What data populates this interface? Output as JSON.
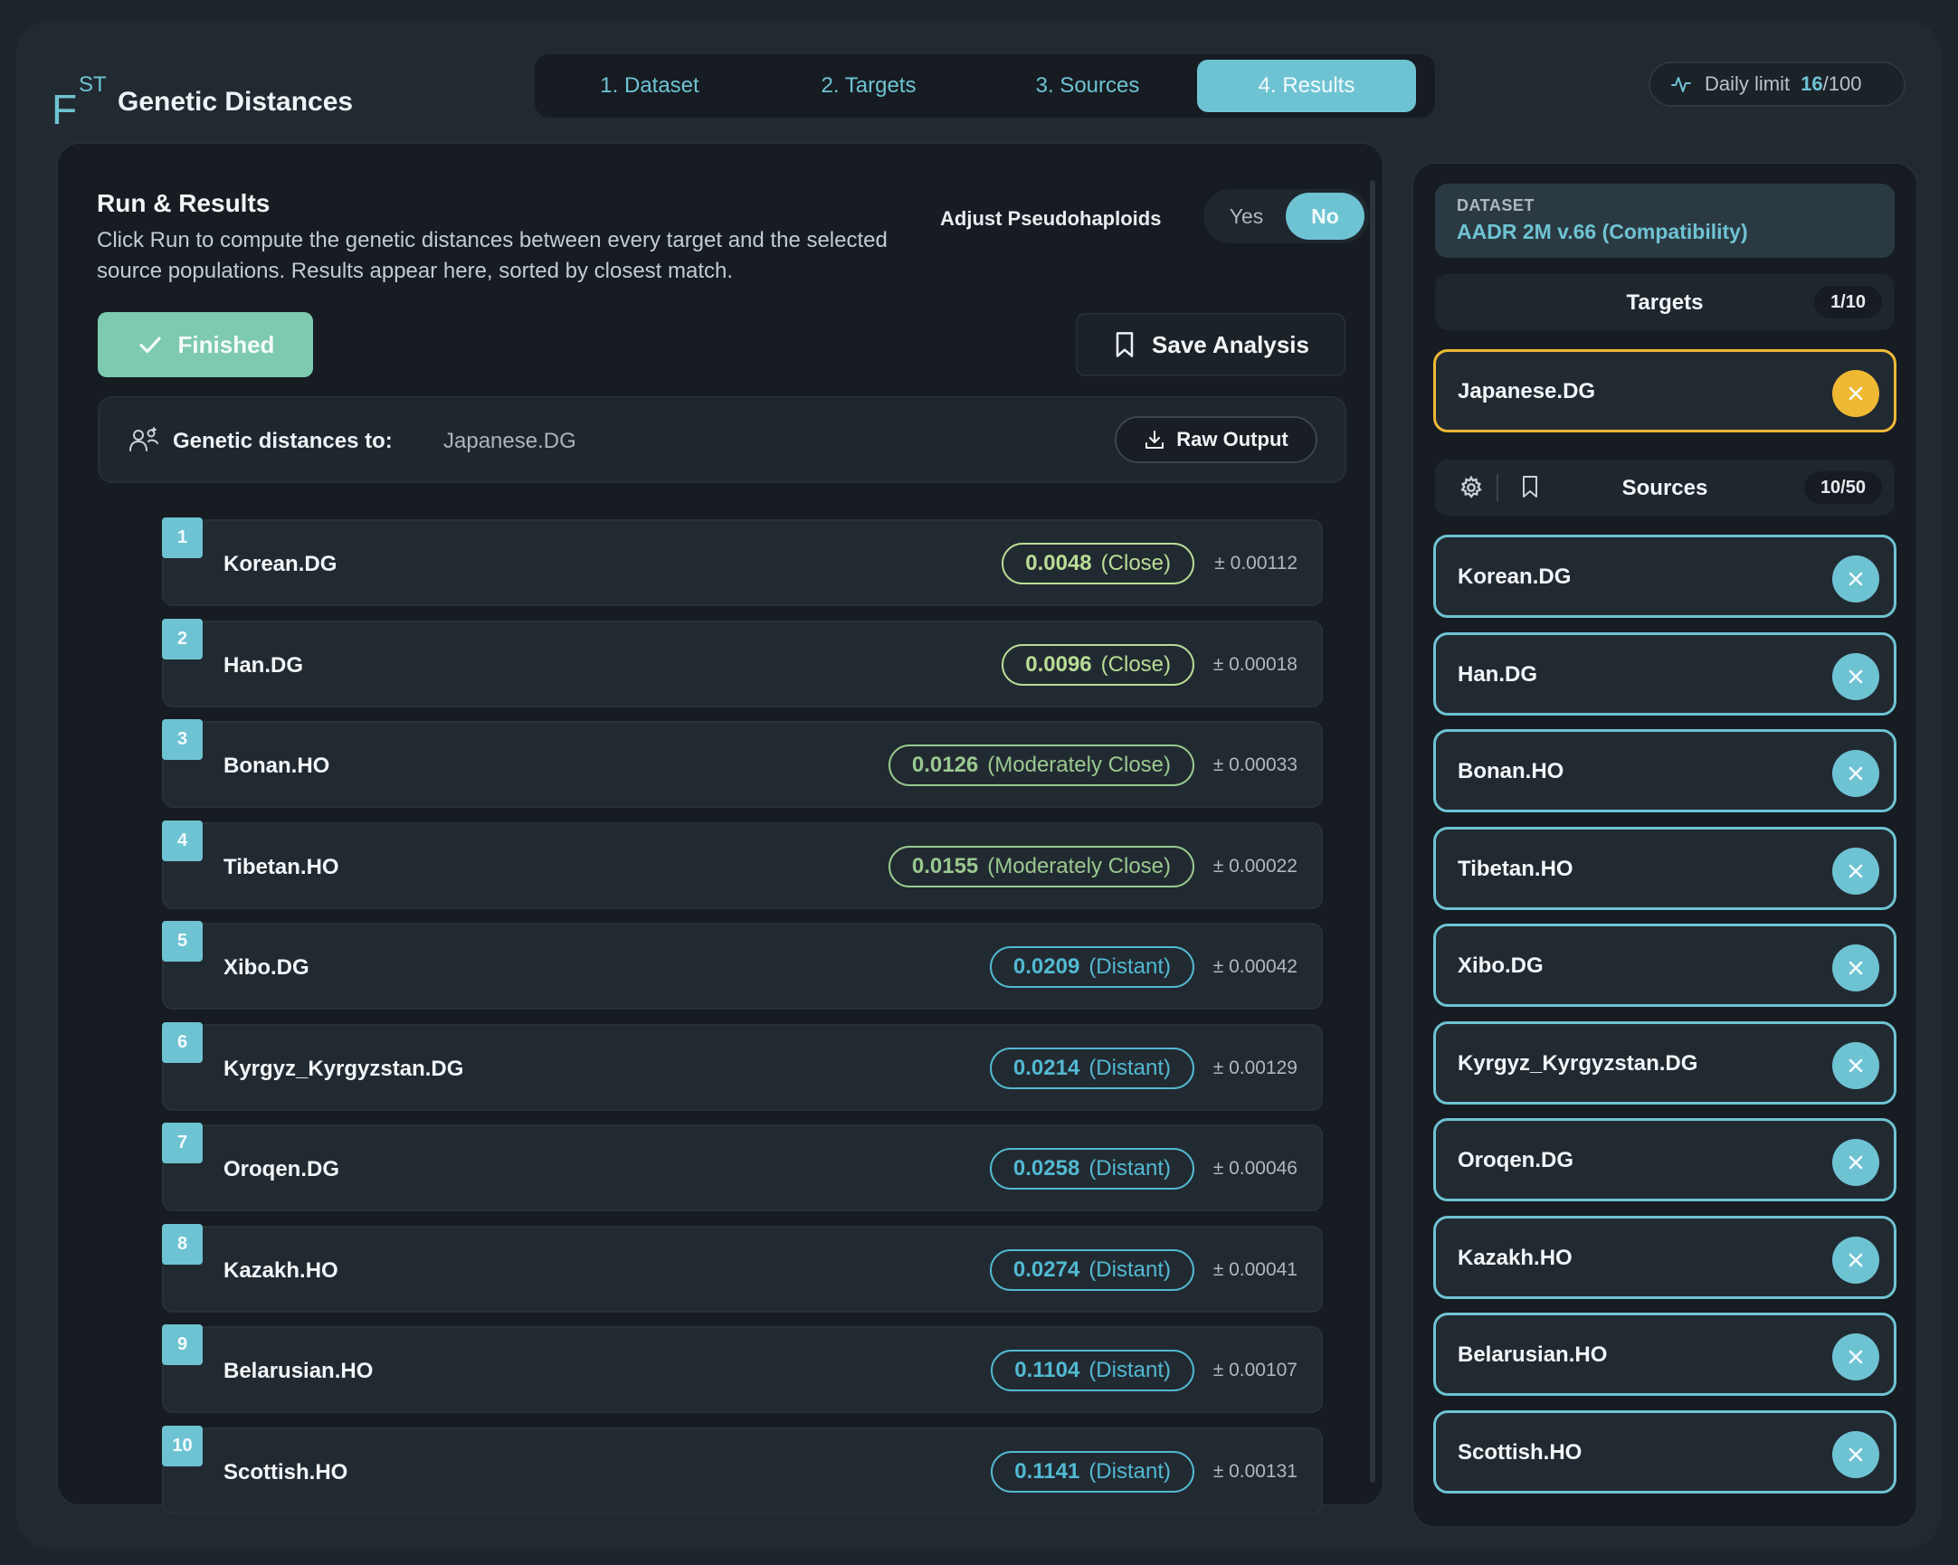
{
  "header": {
    "logo_main": "F",
    "logo_sup": "ST",
    "title": "Genetic Distances",
    "tabs": [
      "1. Dataset",
      "2. Targets",
      "3. Sources",
      "4. Results"
    ],
    "active_tab": 3,
    "limit_label": "Daily limit",
    "limit_used": "16",
    "limit_total": "/100"
  },
  "main": {
    "title": "Run & Results",
    "description": "Click Run to compute the genetic distances between every target and the selected source populations. Results appear here, sorted by closest match.",
    "adjust_label": "Adjust Pseudohaploids",
    "toggle_yes": "Yes",
    "toggle_no": "No",
    "toggle_selected": "No",
    "finished_label": "Finished",
    "save_label": "Save Analysis",
    "distances_label": "Genetic distances to:",
    "distances_target": "Japanese.DG",
    "raw_output_label": "Raw Output",
    "results": [
      {
        "rank": "1",
        "name": "Korean.DG",
        "value": "0.0048",
        "category": "(Close)",
        "err": "± 0.00112",
        "cls": "close"
      },
      {
        "rank": "2",
        "name": "Han.DG",
        "value": "0.0096",
        "category": "(Close)",
        "err": "± 0.00018",
        "cls": "close"
      },
      {
        "rank": "3",
        "name": "Bonan.HO",
        "value": "0.0126",
        "category": "(Moderately Close)",
        "err": "± 0.00033",
        "cls": "mod"
      },
      {
        "rank": "4",
        "name": "Tibetan.HO",
        "value": "0.0155",
        "category": "(Moderately Close)",
        "err": "± 0.00022",
        "cls": "mod"
      },
      {
        "rank": "5",
        "name": "Xibo.DG",
        "value": "0.0209",
        "category": "(Distant)",
        "err": "± 0.00042",
        "cls": "dist"
      },
      {
        "rank": "6",
        "name": "Kyrgyz_Kyrgyzstan.DG",
        "value": "0.0214",
        "category": "(Distant)",
        "err": "± 0.00129",
        "cls": "dist"
      },
      {
        "rank": "7",
        "name": "Oroqen.DG",
        "value": "0.0258",
        "category": "(Distant)",
        "err": "± 0.00046",
        "cls": "dist"
      },
      {
        "rank": "8",
        "name": "Kazakh.HO",
        "value": "0.0274",
        "category": "(Distant)",
        "err": "± 0.00041",
        "cls": "dist"
      },
      {
        "rank": "9",
        "name": "Belarusian.HO",
        "value": "0.1104",
        "category": "(Distant)",
        "err": "± 0.00107",
        "cls": "dist"
      },
      {
        "rank": "10",
        "name": "Scottish.HO",
        "value": "0.1141",
        "category": "(Distant)",
        "err": "± 0.00131",
        "cls": "dist"
      }
    ]
  },
  "sidebar": {
    "dataset_caption": "DATASET",
    "dataset_value": "AADR 2M v.66 (Compatibility)",
    "targets_label": "Targets",
    "targets_count": "1/10",
    "targets": [
      "Japanese.DG"
    ],
    "sources_label": "Sources",
    "sources_count": "10/50",
    "sources": [
      "Korean.DG",
      "Han.DG",
      "Bonan.HO",
      "Tibetan.HO",
      "Xibo.DG",
      "Kyrgyz_Kyrgyzstan.DG",
      "Oroqen.DG",
      "Kazakh.HO",
      "Belarusian.HO",
      "Scottish.HO"
    ]
  },
  "colors": {
    "accent": "#6ec3d3",
    "close": "#b9dd95",
    "moderately_close": "#9ac990",
    "distant": "#52b9d2",
    "target_highlight": "#efb934",
    "finished": "#7ecab1"
  },
  "icons": [
    "activity-icon",
    "check-icon",
    "bookmark-icon",
    "users-icon",
    "download-icon",
    "gear-icon",
    "close-icon"
  ]
}
